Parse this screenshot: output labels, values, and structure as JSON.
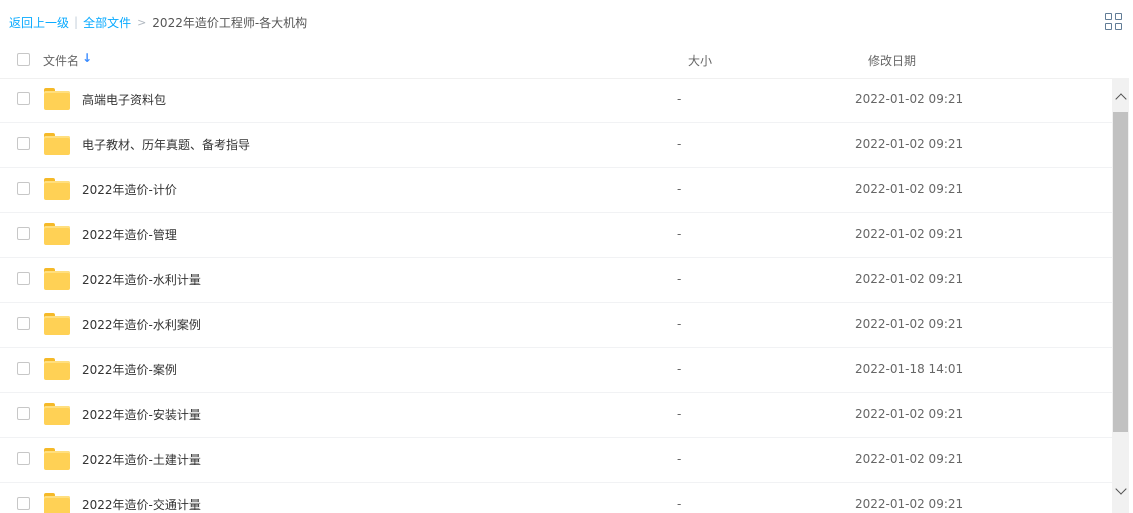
{
  "breadcrumb": {
    "back_label": "返回上一级",
    "separator": "|",
    "root_label": "全部文件",
    "arrow": ">",
    "current_label": "2022年造价工程师-各大机构"
  },
  "header": {
    "name_label": "文件名",
    "sort_icon": "arrow-down-icon",
    "size_label": "大小",
    "date_label": "修改日期"
  },
  "files": [
    {
      "name": "高端电子资料包",
      "size": "-",
      "date": "2022-01-02 09:21"
    },
    {
      "name": "电子教材、历年真题、备考指导",
      "size": "-",
      "date": "2022-01-02 09:21"
    },
    {
      "name": "2022年造价-计价",
      "size": "-",
      "date": "2022-01-02 09:21"
    },
    {
      "name": "2022年造价-管理",
      "size": "-",
      "date": "2022-01-02 09:21"
    },
    {
      "name": "2022年造价-水利计量",
      "size": "-",
      "date": "2022-01-02 09:21"
    },
    {
      "name": "2022年造价-水利案例",
      "size": "-",
      "date": "2022-01-02 09:21"
    },
    {
      "name": "2022年造价-案例",
      "size": "-",
      "date": "2022-01-18 14:01"
    },
    {
      "name": "2022年造价-安装计量",
      "size": "-",
      "date": "2022-01-02 09:21"
    },
    {
      "name": "2022年造价-土建计量",
      "size": "-",
      "date": "2022-01-02 09:21"
    },
    {
      "name": "2022年造价-交通计量",
      "size": "-",
      "date": "2022-01-02 09:21"
    }
  ],
  "colors": {
    "link": "#09aaff",
    "folder": "#ffd155",
    "sort_arrow": "#3b8cff"
  }
}
